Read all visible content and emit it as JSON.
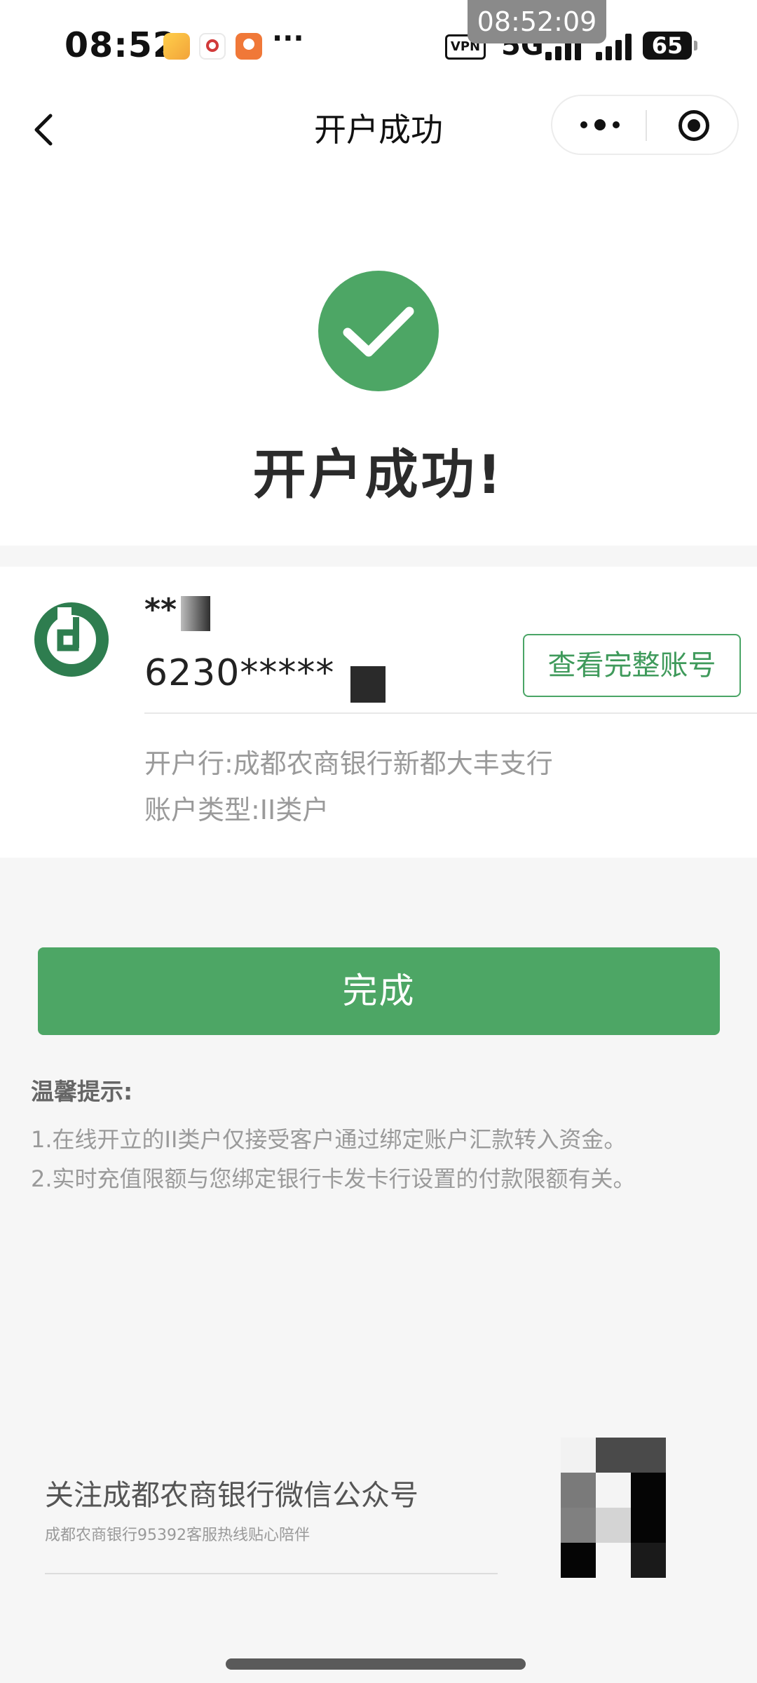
{
  "status_bar": {
    "time": "08:52",
    "more": "···",
    "overlay_time": "08:52:09",
    "vpn": "VPN",
    "network": "5G",
    "battery": "65"
  },
  "nav": {
    "title": "开户成功"
  },
  "success": {
    "title": "开户成功!"
  },
  "account": {
    "name": "**",
    "number": "6230*****",
    "view_full_label": "查看完整账号",
    "bank_label": "开户行:成都农商银行新都大丰支行",
    "type_label": "账户类型:II类户"
  },
  "actions": {
    "done_label": "完成"
  },
  "tips": {
    "title": "温馨提示:",
    "lines": [
      "1.在线开立的II类户仅接受客户通过绑定账户汇款转入资金。",
      "2.实时充值限额与您绑定银行卡发卡行设置的付款限额有关。"
    ]
  },
  "footer": {
    "follow_title": "关注成都农商银行微信公众号",
    "follow_subtitle": "成都农商银行95392客服热线贴心陪伴"
  },
  "colors": {
    "brand_green": "#4da665",
    "logo_green": "#2e7d4f",
    "page_bg": "#f6f6f6"
  }
}
